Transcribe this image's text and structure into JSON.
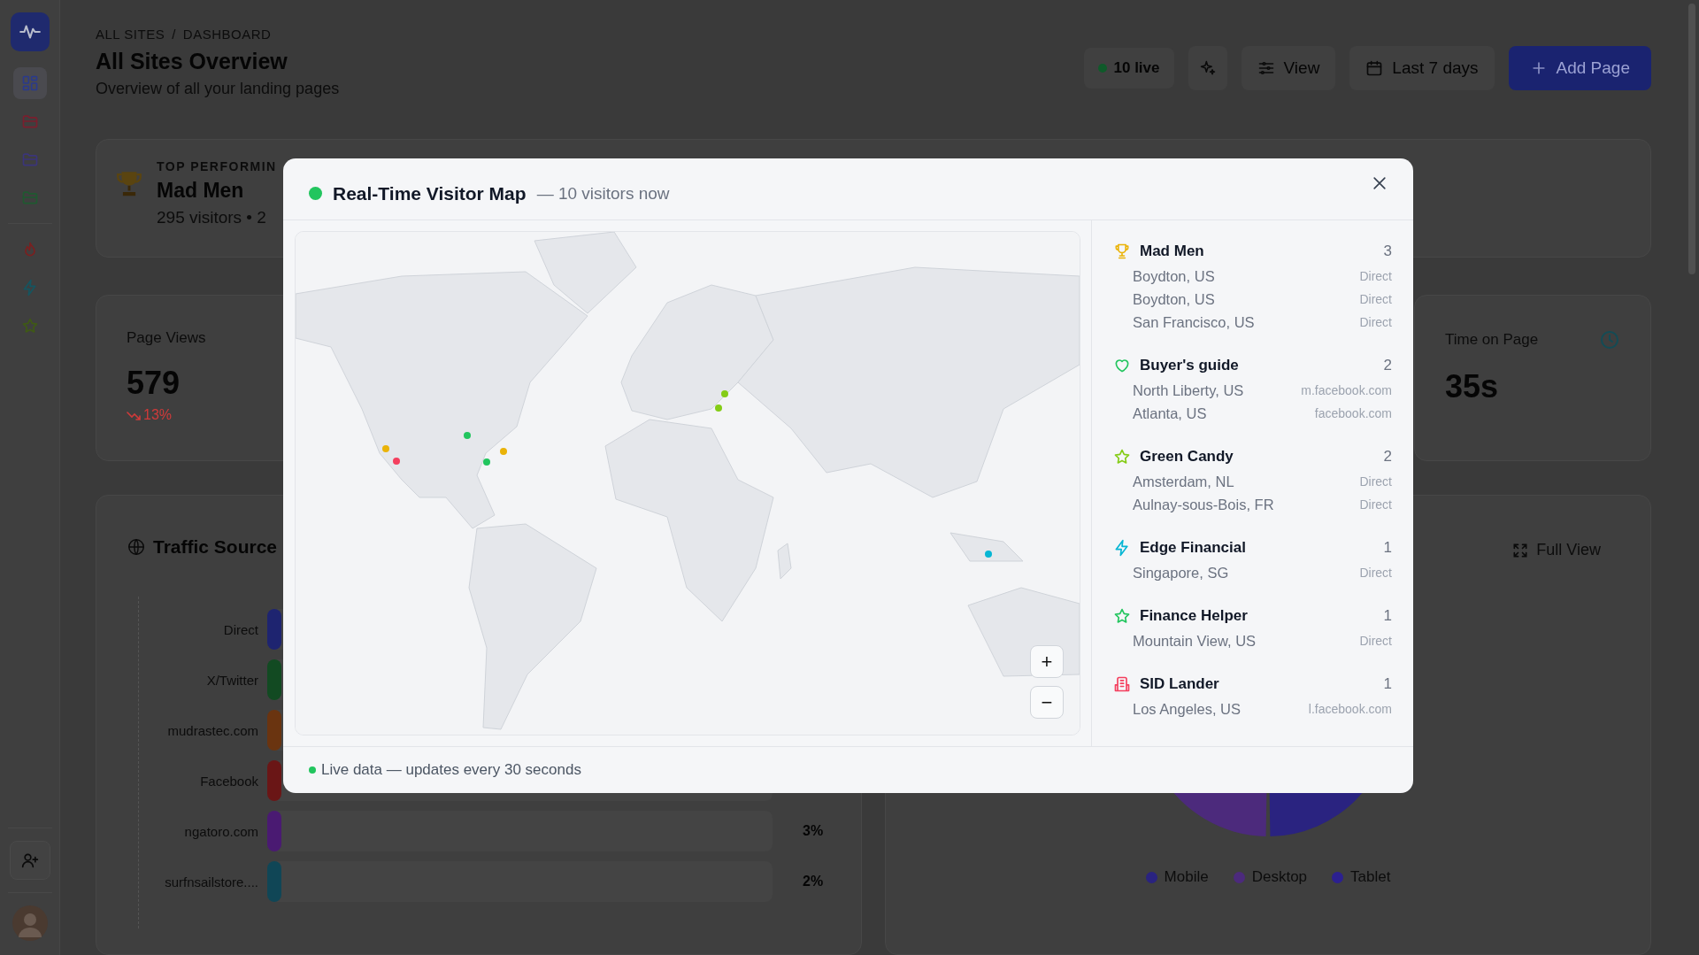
{
  "sidebar": {
    "items": [
      {
        "kind": "grid",
        "color": "#2a3a8c",
        "selected": true
      },
      {
        "kind": "folder",
        "color": "#7a1f2e",
        "selected": false
      },
      {
        "kind": "folder",
        "color": "#3b357a",
        "selected": false
      },
      {
        "kind": "folder",
        "color": "#1f5a30",
        "selected": false
      },
      {
        "kind": "flame",
        "color": "#7a2020",
        "selected": false
      },
      {
        "kind": "bolt",
        "color": "#155560",
        "selected": false
      },
      {
        "kind": "star",
        "color": "#3f5a14",
        "selected": false
      }
    ]
  },
  "breadcrumb": {
    "items": [
      "ALL SITES",
      "DASHBOARD"
    ],
    "separator": "/"
  },
  "title": "All Sites Overview",
  "subtitle": "Overview of all your landing pages",
  "header_actions": {
    "live": "10 live",
    "view": "View",
    "range": "Last 7 days",
    "add": "Add Page"
  },
  "top_performer": {
    "label": "TOP PERFORMIN",
    "name": "Mad Men",
    "meta": "295 visitors • 2"
  },
  "stats": [
    {
      "kind": "views",
      "label": "Page Views",
      "value": "579",
      "change": "13%",
      "declining": true
    },
    {
      "kind": "time",
      "label": "Time on Page",
      "value": "35s"
    }
  ],
  "traffic_sources": {
    "title": "Traffic Source",
    "rows": [
      {
        "label": "Direct",
        "color": "#1e2470"
      },
      {
        "label": "X/Twitter",
        "color": "#124a22"
      },
      {
        "label": "mudrastec.com",
        "color": "#6a3410"
      },
      {
        "label": "Facebook",
        "color": "#6a1616"
      },
      {
        "label": "ngatoro.com",
        "color": "#4a1a72",
        "percent": "3%"
      },
      {
        "label": "surfnsailstore....",
        "color": "#104656",
        "percent": "2%"
      }
    ]
  },
  "devices": {
    "button": "Full View",
    "legend": [
      {
        "label": "Mobile",
        "color": "#2a2380"
      },
      {
        "label": "Desktop",
        "color": "#4c2a7c"
      },
      {
        "label": "Tablet",
        "color": "#2c2090"
      }
    ]
  },
  "modal": {
    "title": "Real-Time Visitor Map",
    "subtitle": "— 10 visitors now",
    "zoom_in": "+",
    "zoom_out": "−",
    "pages": [
      {
        "kind": "trophy",
        "color": "#eab308",
        "name": "Mad Men",
        "count": "3",
        "visits": [
          {
            "city": "Boydton, US",
            "source": "Direct"
          },
          {
            "city": "Boydton, US",
            "source": "Direct"
          },
          {
            "city": "San Francisco, US",
            "source": "Direct"
          }
        ]
      },
      {
        "kind": "heart",
        "color": "#22c55e",
        "name": "Buyer's guide",
        "count": "2",
        "visits": [
          {
            "city": "North Liberty, US",
            "source": "m.facebook.com"
          },
          {
            "city": "Atlanta, US",
            "source": "facebook.com"
          }
        ]
      },
      {
        "kind": "star",
        "color": "#84cc16",
        "name": "Green Candy",
        "count": "2",
        "visits": [
          {
            "city": "Amsterdam, NL",
            "source": "Direct"
          },
          {
            "city": "Aulnay-sous-Bois, FR",
            "source": "Direct"
          }
        ]
      },
      {
        "kind": "bolt",
        "color": "#06b6d4",
        "name": "Edge Financial",
        "count": "1",
        "visits": [
          {
            "city": "Singapore, SG",
            "source": "Direct"
          }
        ]
      },
      {
        "kind": "star",
        "color": "#22c55e",
        "name": "Finance Helper",
        "count": "1",
        "visits": [
          {
            "city": "Mountain View, US",
            "source": "Direct"
          }
        ]
      },
      {
        "kind": "building",
        "color": "#f43f5e",
        "name": "SID Lander",
        "count": "1",
        "visits": [
          {
            "city": "Los Angeles, US",
            "source": "l.facebook.com"
          }
        ]
      }
    ],
    "footer": "Live data — updates every 30 seconds"
  }
}
